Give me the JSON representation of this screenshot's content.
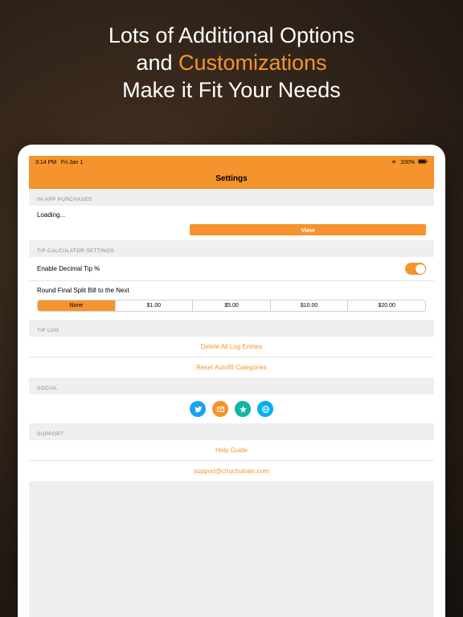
{
  "headline": {
    "line1": "Lots of Additional Options",
    "line2a": "and ",
    "accent": "Customizations",
    "line3": "Make it Fit Your Needs"
  },
  "statusbar": {
    "time": "3:14 PM",
    "date": "Fri Jan 1",
    "battery": "100%"
  },
  "navbar": {
    "title": "Settings"
  },
  "sections": {
    "iap": {
      "header": "IN-APP PURCHASES",
      "loading": "Loading...",
      "view": "View"
    },
    "calc": {
      "header": "TIP CALCULATOR SETTINGS",
      "enableDecimal": "Enable Decimal Tip %",
      "roundLabel": "Round Final Split Bill to the Next",
      "options": [
        "None",
        "$1.00",
        "$5.00",
        "$10.00",
        "$20.00"
      ],
      "selectedIndex": 0
    },
    "tiplog": {
      "header": "TIP LOG",
      "deleteAll": "Delete All Log Entries",
      "resetCategories": "Reset Autofill Categories"
    },
    "social": {
      "header": "SOCIAL"
    },
    "support": {
      "header": "SUPPORT",
      "helpGuide": "Help Guide",
      "email": "support@chuchutrain.com"
    }
  }
}
